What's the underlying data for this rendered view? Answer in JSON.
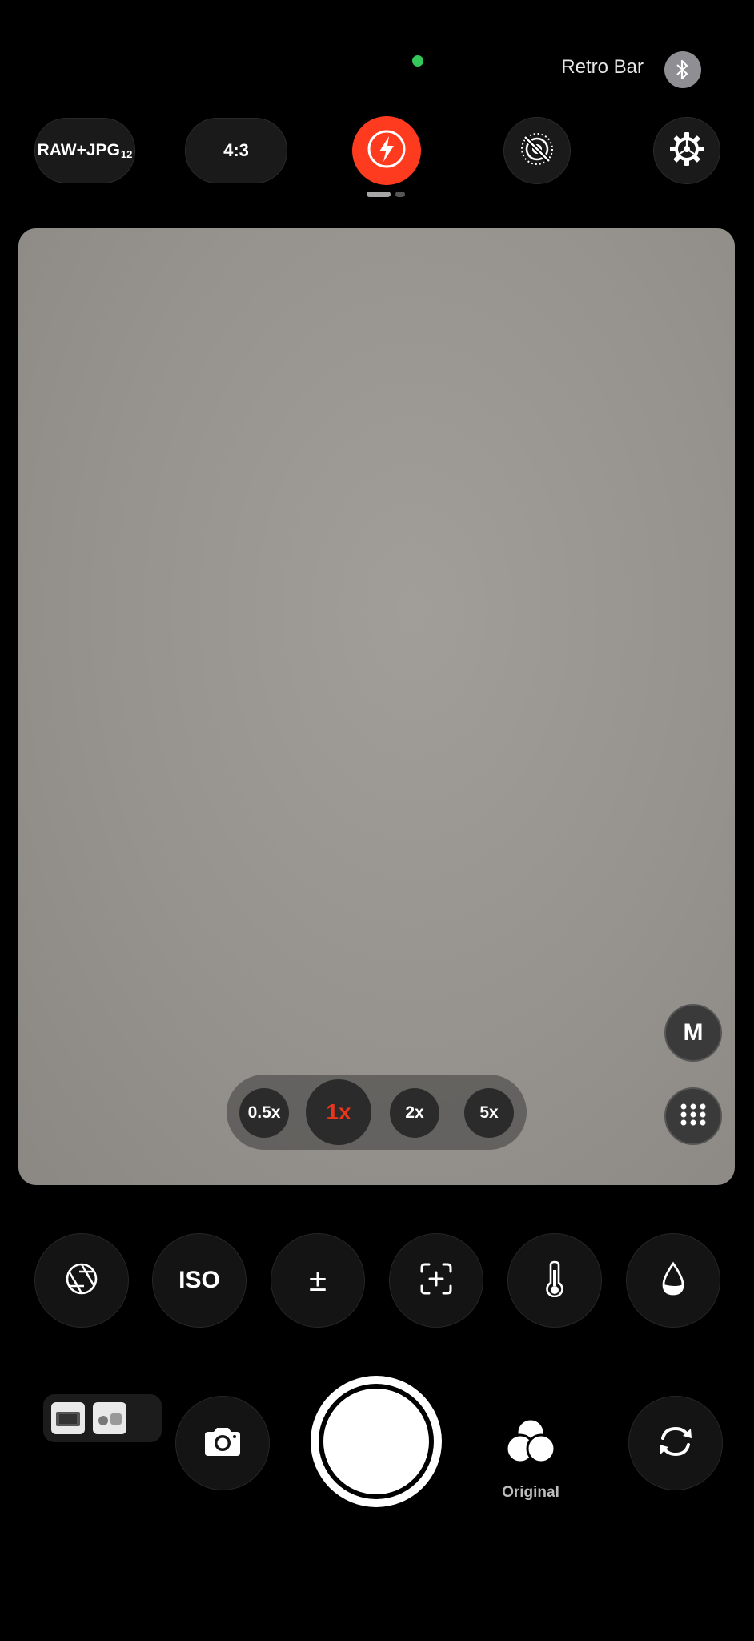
{
  "status": {
    "device_name": "Retro Bar",
    "bluetooth_icon": "bluetooth-icon",
    "indicator_color": "#34c759"
  },
  "top_bar": {
    "format_label": "RAW+JPG",
    "format_sub": "12",
    "ratio_label": "4:3",
    "flash_icon": "flash-icon",
    "flash_color": "#ff3b1f",
    "live_off_icon": "live-photo-off-icon",
    "settings_icon": "gear-icon"
  },
  "viewfinder": {
    "mode_label": "M",
    "grid_icon": "grid-icon",
    "zoom": {
      "options": [
        "0.5x",
        "1x",
        "2x",
        "5x"
      ],
      "selected": "1x",
      "selected_color": "#e8351b"
    }
  },
  "tools": {
    "aperture_icon": "aperture-icon",
    "iso_label": "ISO",
    "exposure_label": "±",
    "focus_icon": "focus-plus-icon",
    "temperature_icon": "thermometer-icon",
    "tint_icon": "droplet-icon"
  },
  "bottom": {
    "gallery_icon": "gallery-thumbnails-icon",
    "camera_icon": "camera-icon",
    "shutter_icon": "shutter-button",
    "filter_icon": "filter-circles-icon",
    "filter_label": "Original",
    "flip_icon": "flip-camera-icon"
  }
}
